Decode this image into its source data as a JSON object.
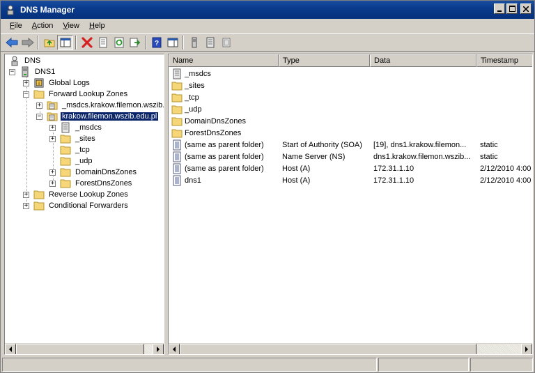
{
  "window": {
    "title": "DNS Manager"
  },
  "menu": [
    {
      "pre": "",
      "key": "F",
      "post": "ile"
    },
    {
      "pre": "",
      "key": "A",
      "post": "ction"
    },
    {
      "pre": "",
      "key": "V",
      "post": "iew"
    },
    {
      "pre": "",
      "key": "H",
      "post": "elp"
    }
  ],
  "toolbar": {
    "buttons": [
      "back",
      "forward",
      "up-folder",
      "show-hide-console-tree",
      "delete",
      "properties",
      "refresh",
      "export-list",
      "help",
      "show-hide-action-pane",
      "server",
      "zone",
      "record"
    ]
  },
  "tree": {
    "root": "DNS",
    "server": "DNS1",
    "global_logs": "Global Logs",
    "forward_zones": "Forward Lookup Zones",
    "msdcs_zone": "_msdcs.krakow.filemon.wszib.e",
    "main_zone": "krakow.filemon.wszib.edu.pl",
    "sub_msdcs": "_msdcs",
    "sub_sites": "_sites",
    "sub_tcp": "_tcp",
    "sub_udp": "_udp",
    "sub_domaindns": "DomainDnsZones",
    "sub_forestdns": "ForestDnsZones",
    "reverse_zones": "Reverse Lookup Zones",
    "conditional_forwarders": "Conditional Forwarders"
  },
  "list": {
    "columns": {
      "name": "Name",
      "type": "Type",
      "data": "Data",
      "timestamp": "Timestamp"
    },
    "rows": [
      {
        "icon": "zone",
        "name": "_msdcs",
        "type": "",
        "data": "",
        "timestamp": ""
      },
      {
        "icon": "folder",
        "name": "_sites",
        "type": "",
        "data": "",
        "timestamp": ""
      },
      {
        "icon": "folder",
        "name": "_tcp",
        "type": "",
        "data": "",
        "timestamp": ""
      },
      {
        "icon": "folder",
        "name": "_udp",
        "type": "",
        "data": "",
        "timestamp": ""
      },
      {
        "icon": "folder",
        "name": "DomainDnsZones",
        "type": "",
        "data": "",
        "timestamp": ""
      },
      {
        "icon": "folder",
        "name": "ForestDnsZones",
        "type": "",
        "data": "",
        "timestamp": ""
      },
      {
        "icon": "record",
        "name": "(same as parent folder)",
        "type": "Start of Authority (SOA)",
        "data": "[19], dns1.krakow.filemon...",
        "timestamp": "static"
      },
      {
        "icon": "record",
        "name": "(same as parent folder)",
        "type": "Name Server (NS)",
        "data": "dns1.krakow.filemon.wszib...",
        "timestamp": "static"
      },
      {
        "icon": "record",
        "name": "(same as parent folder)",
        "type": "Host (A)",
        "data": "172.31.1.10",
        "timestamp": "2/12/2010 4:00"
      },
      {
        "icon": "record",
        "name": "dns1",
        "type": "Host (A)",
        "data": "172.31.1.10",
        "timestamp": "2/12/2010 4:00"
      }
    ]
  },
  "colors": {
    "selection": "#0a246a",
    "folder": "#f5d77a",
    "titlebar": "#0a3b8c",
    "delete_red": "#d42020"
  }
}
